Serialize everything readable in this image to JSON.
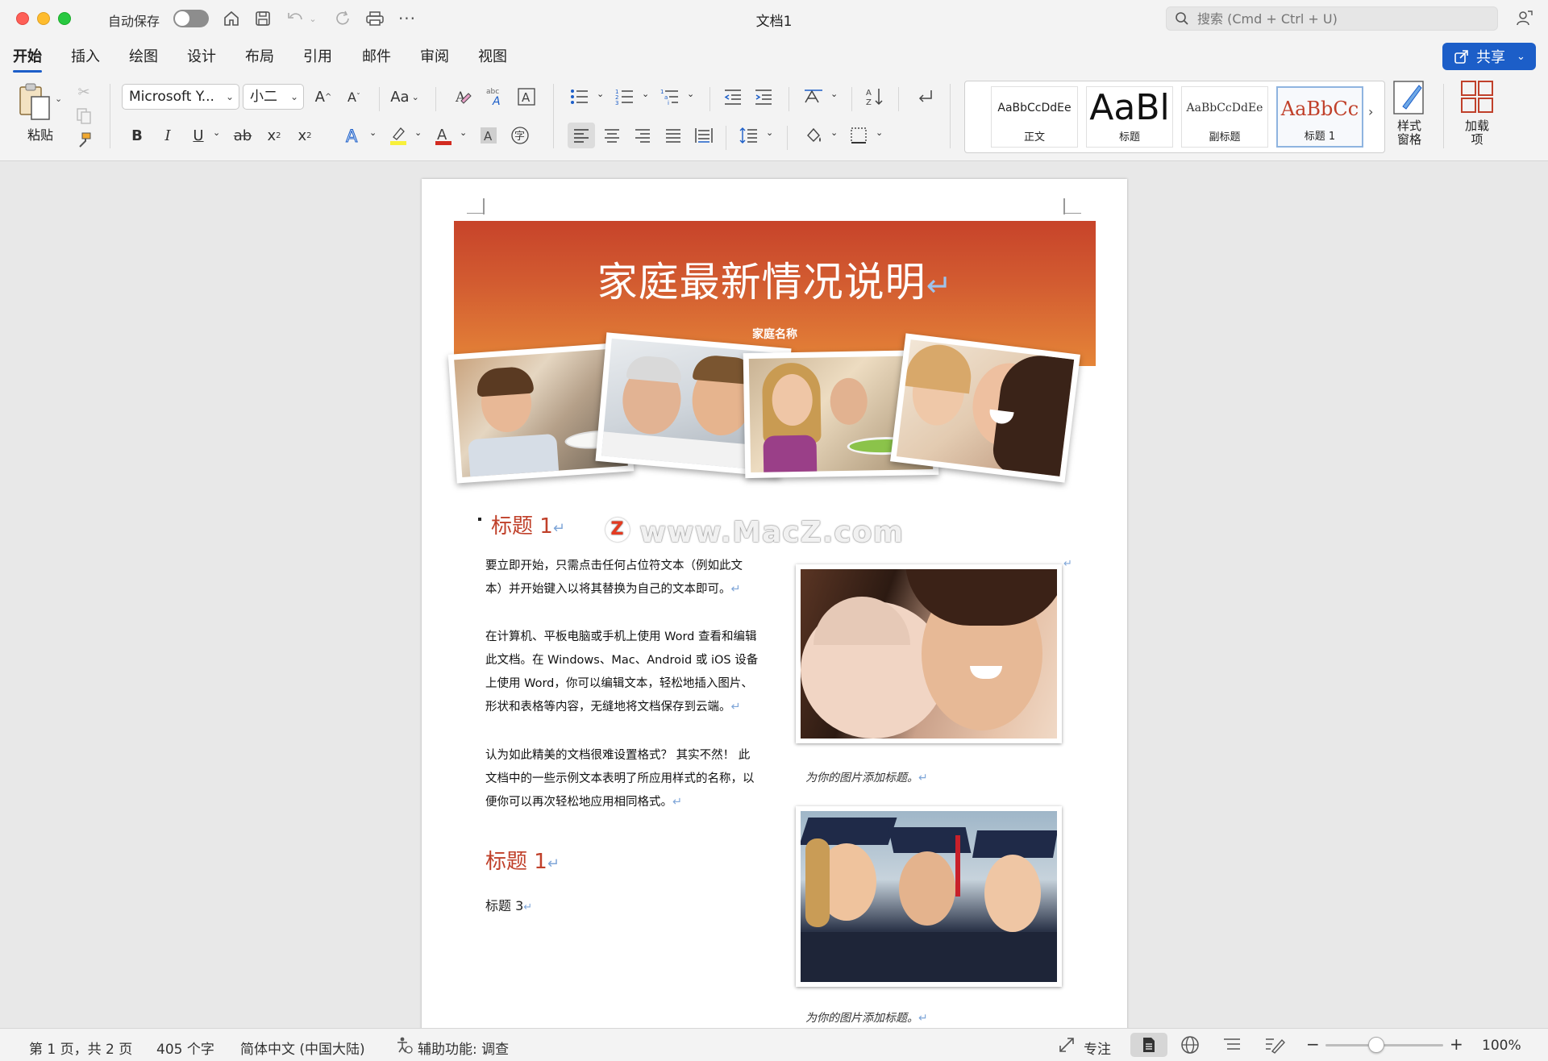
{
  "window": {
    "title": "文档1",
    "autosave_label": "自动保存"
  },
  "search": {
    "placeholder": "搜索 (Cmd + Ctrl + U)"
  },
  "tabs": [
    "开始",
    "插入",
    "绘图",
    "设计",
    "布局",
    "引用",
    "邮件",
    "审阅",
    "视图"
  ],
  "share_label": "共享",
  "ribbon": {
    "paste_label": "粘贴",
    "font_name": "Microsoft Y...",
    "font_size": "小二",
    "styles": [
      {
        "preview": "AaBbCcDdEe",
        "name": "正文"
      },
      {
        "preview": "AaBl",
        "name": "标题"
      },
      {
        "preview": "AaBbCcDdEe",
        "name": "副标题"
      },
      {
        "preview": "AaBbCc",
        "name": "标题 1"
      }
    ],
    "styles_pane_label": "样式\n窗格",
    "addins_label": "加载\n项"
  },
  "document": {
    "banner_title": "家庭最新情况说明",
    "banner_subtitle": "家庭名称",
    "paragraph_mark": "↵",
    "heading1a": "标题 1",
    "para1": "要立即开始，只需点击任何占位符文本（例如此文本）并开始键入以将其替换为自己的文本即可。",
    "para2": "在计算机、平板电脑或手机上使用 Word 查看和编辑此文档。在 Windows、Mac、Android 或 iOS 设备上使用 Word，你可以编辑文本，轻松地插入图片、形状和表格等内容，无缝地将文档保存到云端。",
    "para3": "认为如此精美的文档很难设置格式？ 其实不然！ 此文档中的一些示例文本表明了所应用样式的名称，以便你可以再次轻松地应用相同格式。",
    "heading1b": "标题 1",
    "heading3": "标题 3",
    "caption1": "为你的图片添加标题。",
    "caption2": "为你的图片添加标题。",
    "watermark": "www.MacZ.com",
    "watermark_logo": "Z"
  },
  "status": {
    "page": "第 1 页，共 2 页",
    "words": "405 个字",
    "language": "简体中文 (中国大陆)",
    "accessibility": "辅助功能: 调查",
    "focus": "专注",
    "zoom": "100%",
    "zoom_level_fraction": 0.43
  },
  "colors": {
    "accent": "#1c5ec8",
    "heading": "#c0402a",
    "banner_top": "#c7432a",
    "banner_bottom": "#e58538"
  }
}
